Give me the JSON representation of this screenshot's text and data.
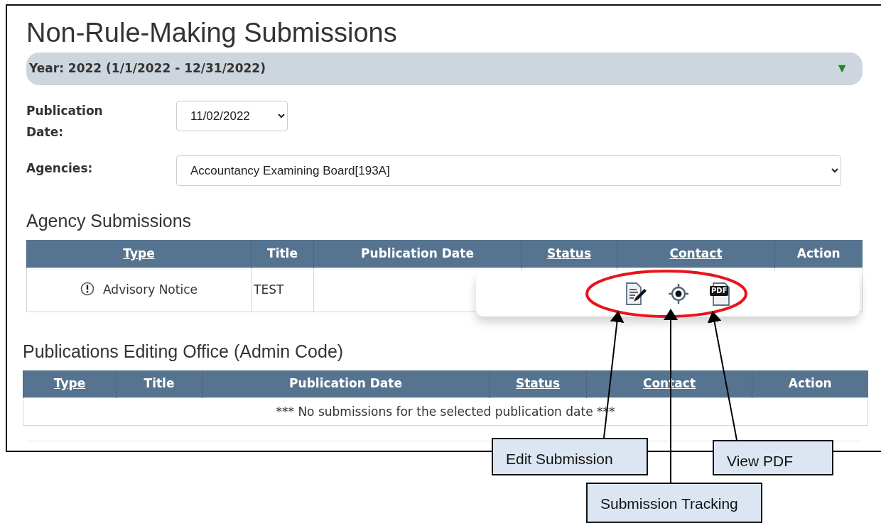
{
  "page": {
    "title": "Non-Rule-Making Submissions"
  },
  "year_bar": {
    "label": "Year: 2022 (1/1/2022 - 12/31/2022)",
    "toggle_icon": "▼",
    "expanded": true
  },
  "filters": [
    {
      "label": "Publication Date:",
      "value": "11/02/2022",
      "kind": "short"
    },
    {
      "label": "Agencies:",
      "value": "Accountancy Examining Board[193A]",
      "kind": "wide"
    }
  ],
  "agency_submissions": {
    "heading": "Agency Submissions",
    "columns": [
      {
        "label": "Type",
        "sortable": true
      },
      {
        "label": "Title",
        "sortable": false
      },
      {
        "label": "Publication Date",
        "sortable": false
      },
      {
        "label": "Status",
        "sortable": true
      },
      {
        "label": "Contact",
        "sortable": true
      },
      {
        "label": "Action",
        "sortable": false
      }
    ],
    "rows": [
      {
        "type": "Advisory Notice",
        "title": "TEST"
      }
    ],
    "action_popup": {
      "actions": [
        {
          "kind": "edit"
        },
        {
          "kind": "track"
        },
        {
          "kind": "pdf",
          "icon_text": "PDF"
        }
      ]
    }
  },
  "editing_office": {
    "heading": "Publications Editing Office (Admin Code)",
    "columns": [
      {
        "label": "Type",
        "sortable": true
      },
      {
        "label": "Title",
        "sortable": false
      },
      {
        "label": "Publication Date",
        "sortable": false
      },
      {
        "label": "Status",
        "sortable": true
      },
      {
        "label": "Contact",
        "sortable": true
      },
      {
        "label": "Action",
        "sortable": false
      }
    ],
    "empty_message": "*** No submissions for the selected publication date ***"
  },
  "callouts": [
    {
      "label": "Edit Submission"
    },
    {
      "label": "View PDF"
    },
    {
      "label": "Submission Tracking"
    }
  ]
}
